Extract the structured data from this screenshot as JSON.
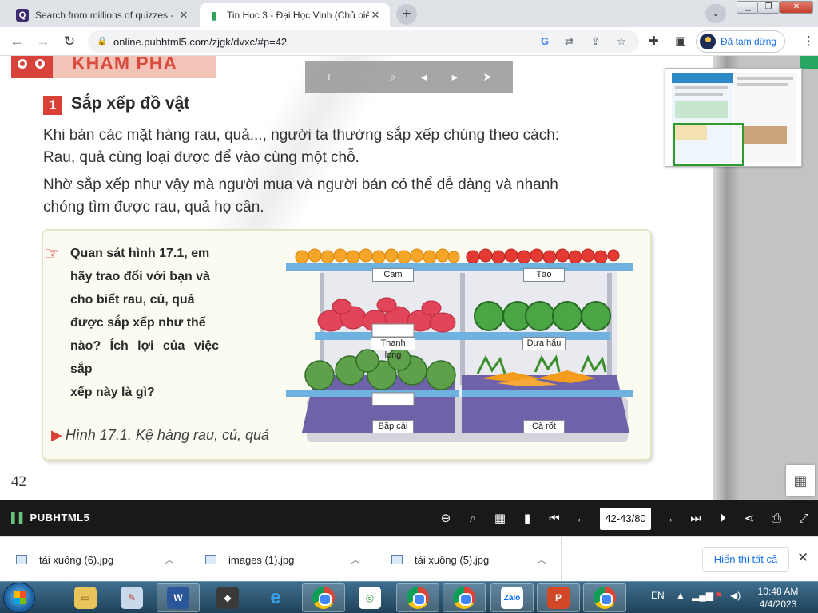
{
  "browser": {
    "tabs": [
      {
        "title": "Search from millions of quizzes - Q",
        "favicon": "Q"
      },
      {
        "title": "Tin Học 3 - Đại Học Vinh (Chủ biên",
        "favicon": "book-icon"
      }
    ],
    "url": "online.pubhtml5.com/zjgk/dvxc/#p=42",
    "profile_label": "Đã tạm dừng"
  },
  "page": {
    "section_header": "KHÁM PHÁ",
    "section_number": "1",
    "section_title": "Sắp xếp đồ vật",
    "paragraph1_line1": "Khi bán các mặt hàng rau, quả..., người ta thường sắp xếp chúng theo cách:",
    "paragraph1_line2": "Rau, quả cùng loại được để vào cùng một chỗ.",
    "paragraph2_line1": "Nhờ sắp xếp như vậy mà người mua và người bán có thể dễ dàng và nhanh",
    "paragraph2_line2": "chóng tìm được rau, quả họ cần.",
    "question_lines": [
      "Quan sát hình 17.1, em",
      "hãy trao đổi với bạn và",
      "cho biết rau, củ, quả",
      "được sắp xếp như thế",
      "nào? Ích lợi của việc sắp",
      "xếp này là gì?"
    ],
    "figure_caption": "Hình 17.1. Kệ hàng rau, củ, quả",
    "shelf_labels": [
      "Cam",
      "Táo",
      "Thanh long",
      "Dưa hấu",
      "Bắp cải",
      "Cà rốt"
    ],
    "page_number": "42"
  },
  "reader": {
    "logo": "PUBHTML5",
    "page_indicator": "42-43/80"
  },
  "downloads": [
    {
      "name": "tải xuống (6).jpg"
    },
    {
      "name": "images (1).jpg"
    },
    {
      "name": "tải xuống (5).jpg"
    }
  ],
  "downloads_show_all": "Hiển thị tất cả",
  "taskbar": {
    "language": "EN",
    "time": "10:48 AM",
    "date": "4/4/2023"
  },
  "colors": {
    "accent_red": "#d94036",
    "shelf_blue": "#6fb2e0",
    "reader_bar": "#191919",
    "link_blue": "#1a73e8"
  }
}
